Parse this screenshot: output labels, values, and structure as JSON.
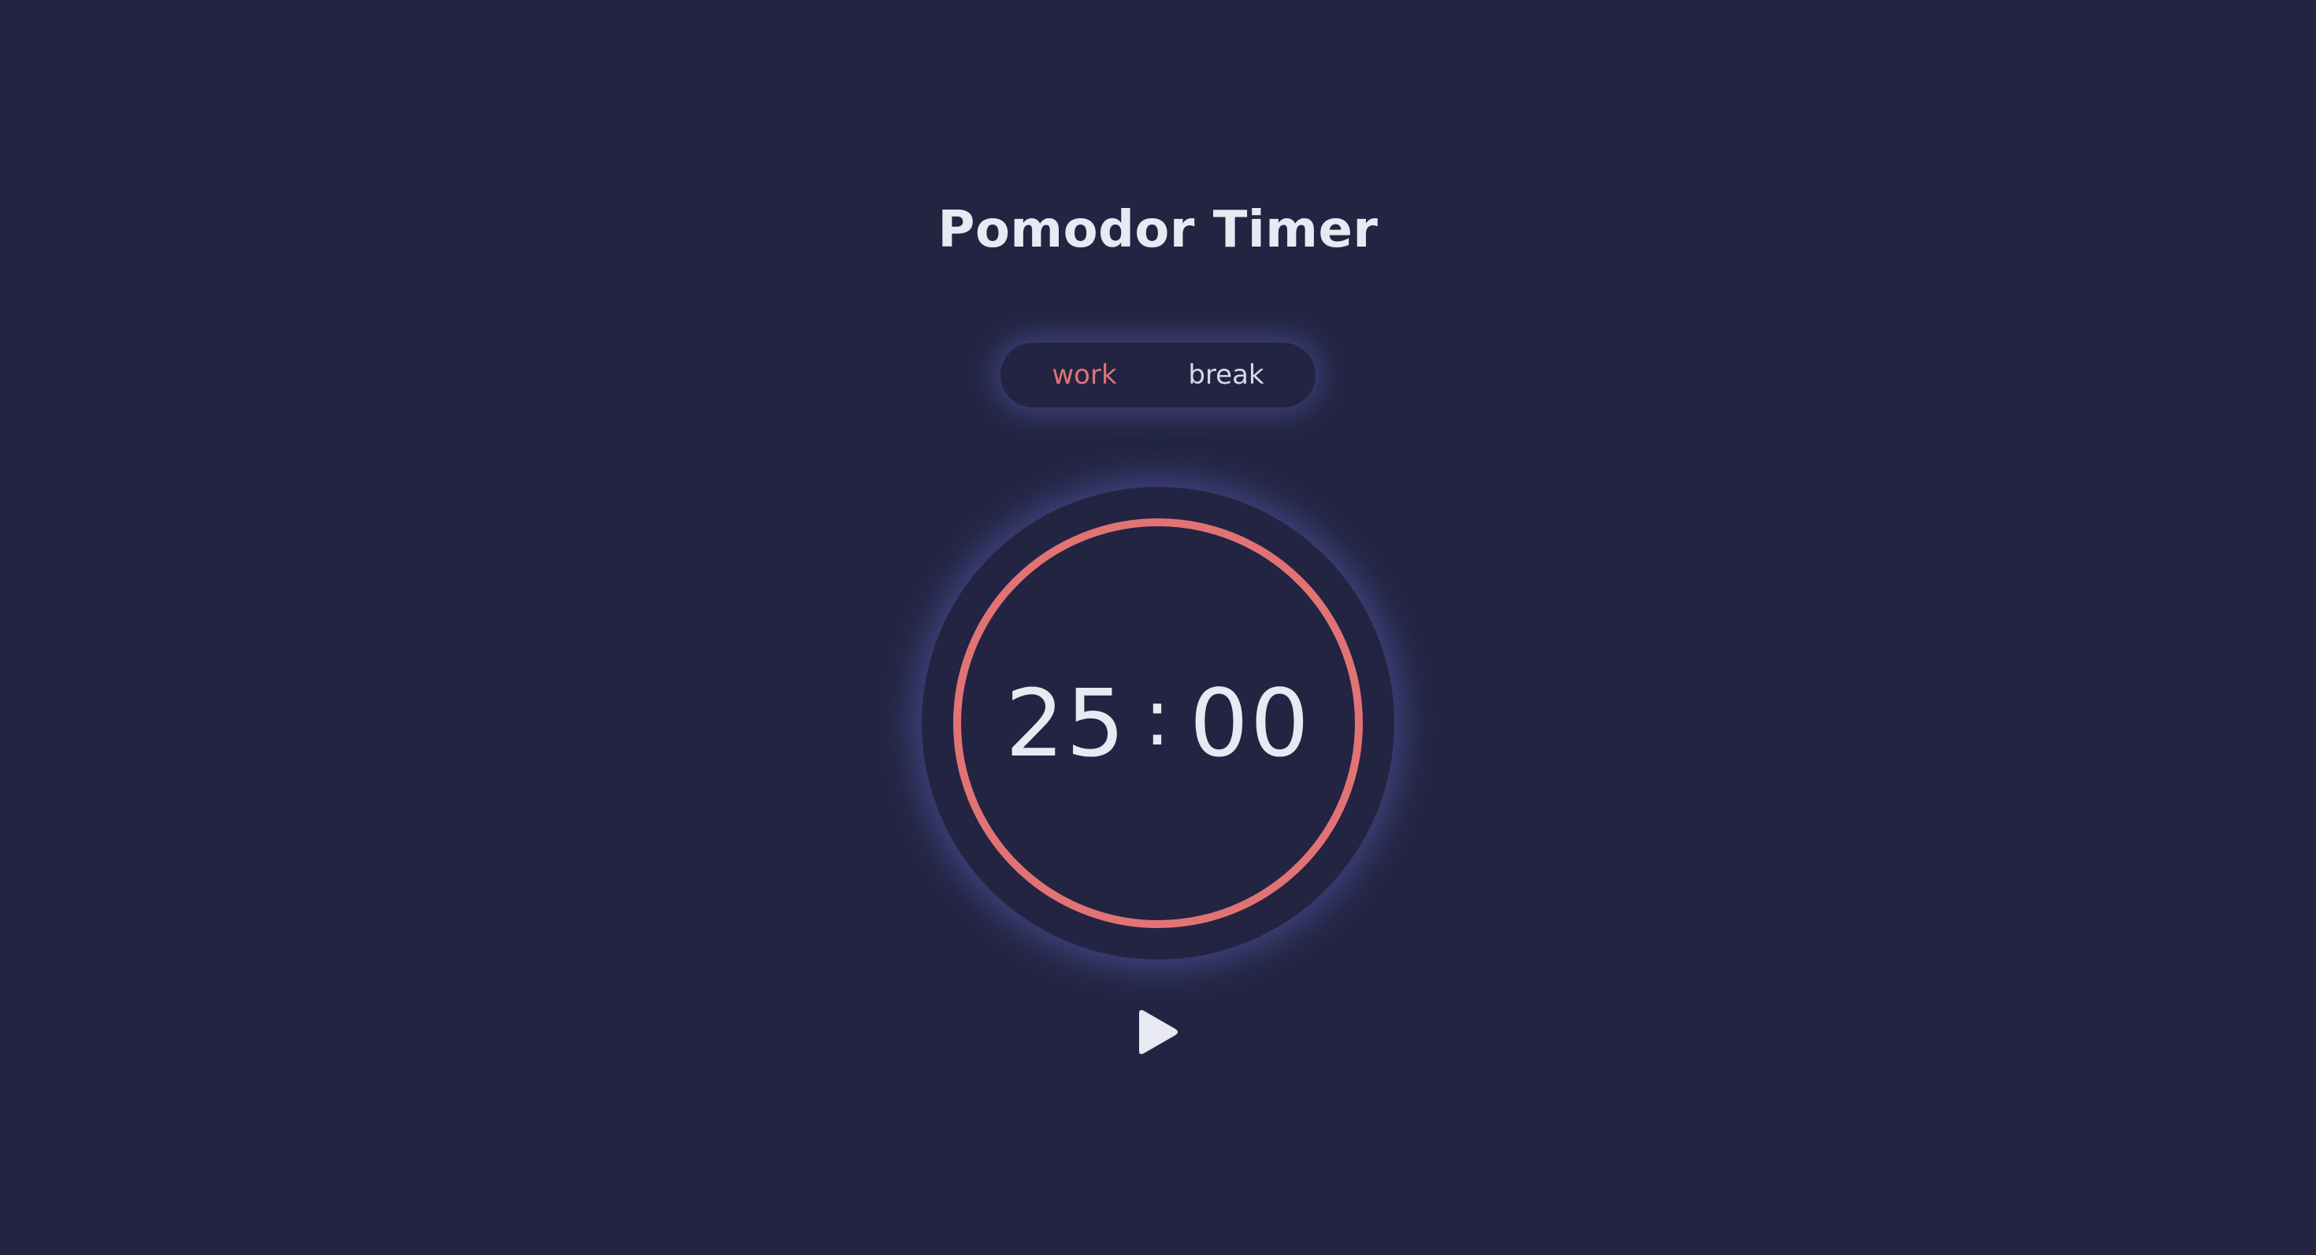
{
  "app": {
    "title": "Pomodor Timer"
  },
  "mode_toggle": {
    "options": [
      {
        "label": "work",
        "active": true
      },
      {
        "label": "break",
        "active": false
      }
    ]
  },
  "timer": {
    "minutes": "25",
    "separator": ":",
    "seconds": "00",
    "progress": 1.0
  },
  "controls": {
    "play_icon": "play-icon"
  },
  "colors": {
    "background": "#222441",
    "accent": "#e27375",
    "text": "#e9e9f4",
    "glow": "#6062be"
  }
}
